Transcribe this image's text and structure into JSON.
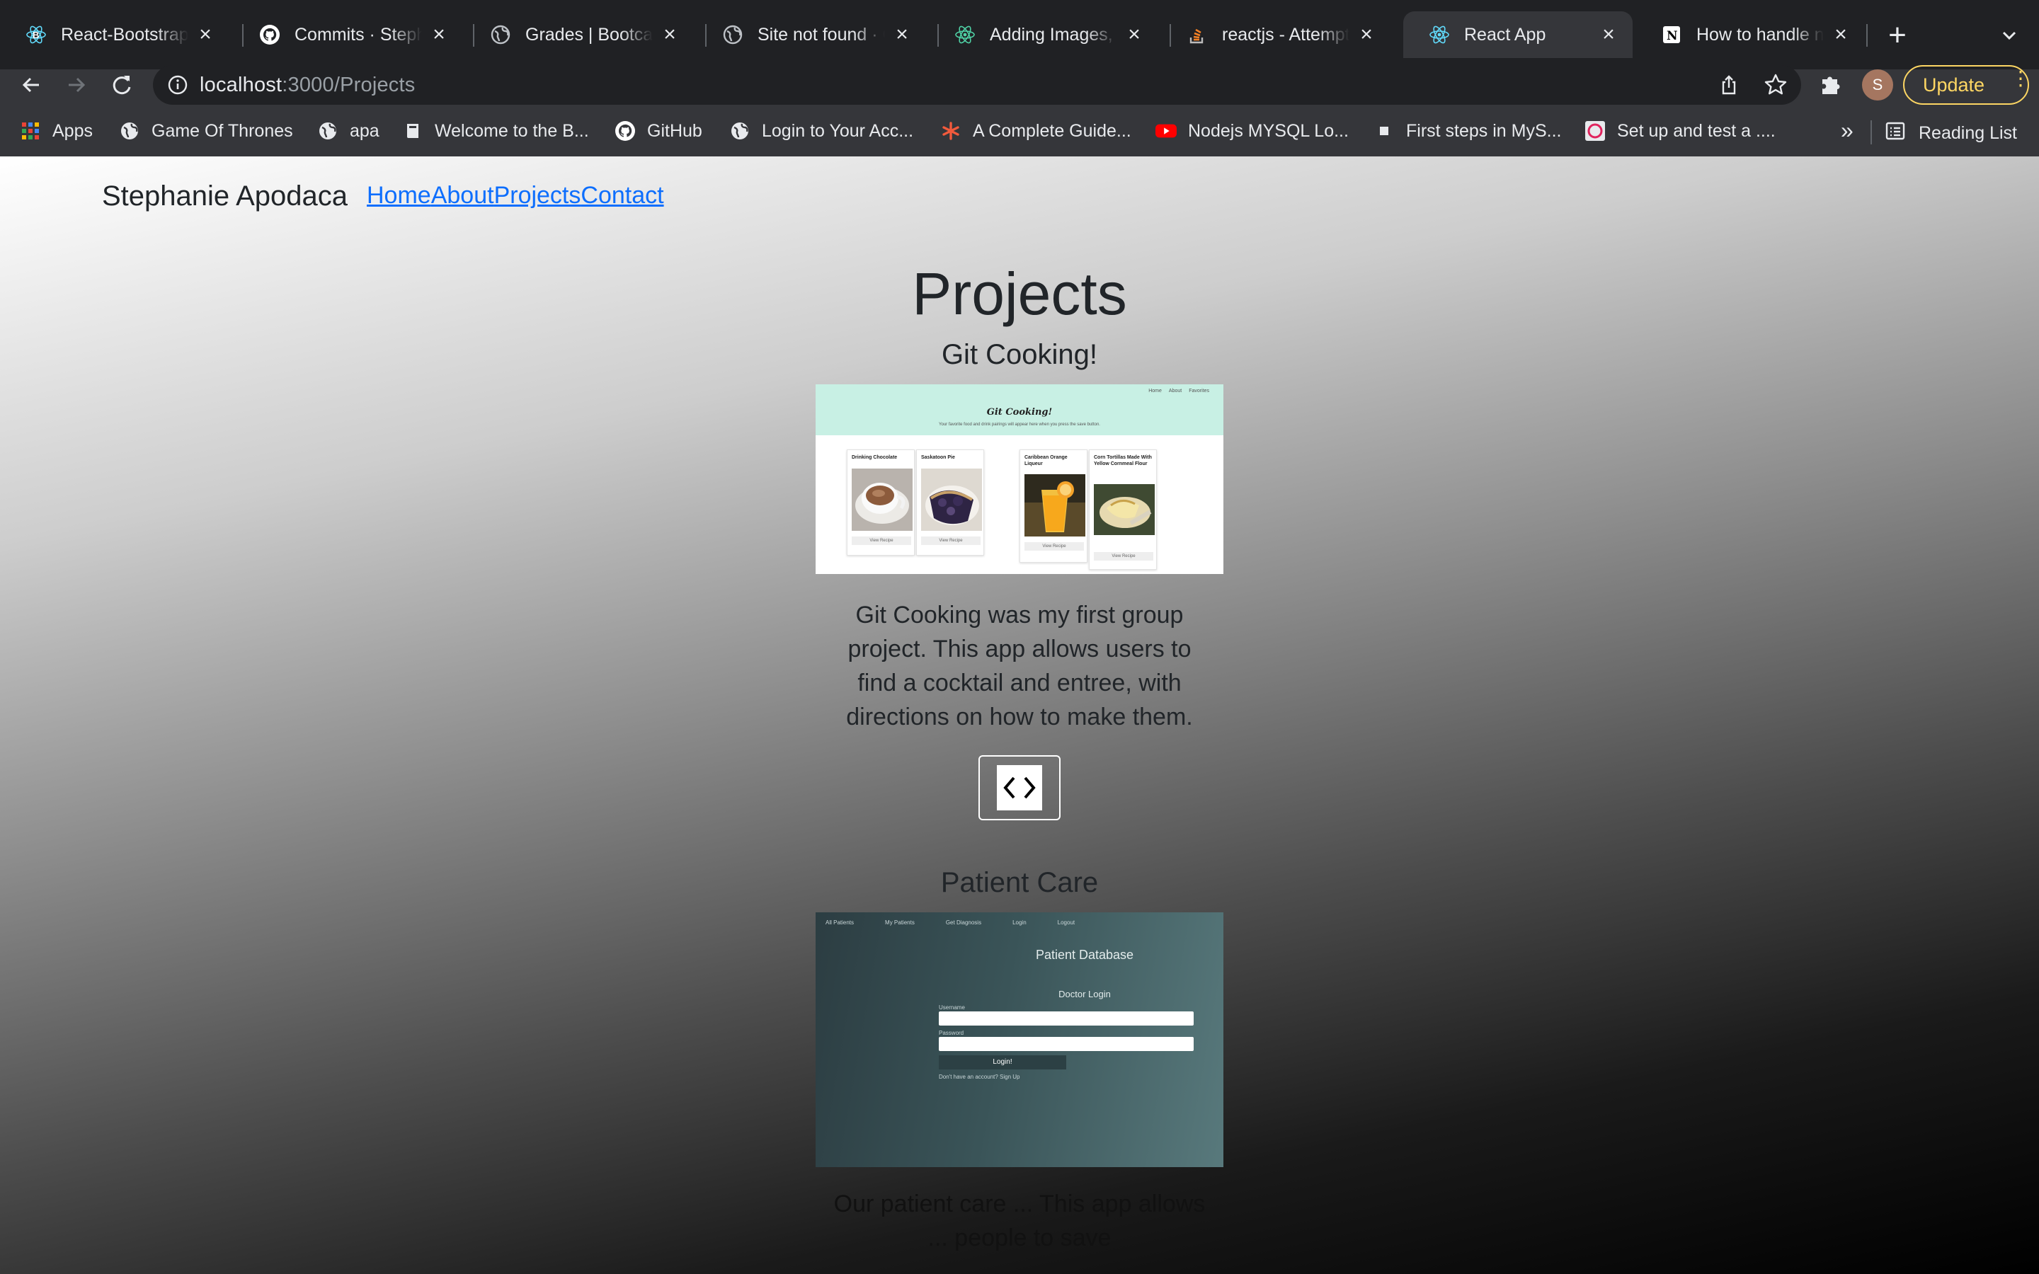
{
  "browser": {
    "tabs": [
      {
        "title": "React-Bootstrap",
        "icon": "react-bootstrap-icon"
      },
      {
        "title": "Commits · StephJ",
        "icon": "github-icon"
      },
      {
        "title": "Grades | Bootcamp",
        "icon": "globe-icon"
      },
      {
        "title": "Site not found · G",
        "icon": "globe-icon"
      },
      {
        "title": "Adding Images, F",
        "icon": "react-icon"
      },
      {
        "title": "reactjs - Attempt",
        "icon": "stackoverflow-icon"
      },
      {
        "title": "React App",
        "icon": "react-icon",
        "active": true
      },
      {
        "title": "How to handle na",
        "icon": "notion-icon"
      }
    ],
    "url_host": "localhost",
    "url_path": ":3000/Projects",
    "avatar_letter": "S",
    "update_label": "Update",
    "bookmarks": [
      {
        "label": "Apps",
        "icon": "apps-grid-icon"
      },
      {
        "label": "Game Of Thrones",
        "icon": "globe-icon"
      },
      {
        "label": "apa",
        "icon": "globe-icon"
      },
      {
        "label": "Welcome to the B...",
        "icon": "book-icon"
      },
      {
        "label": "GitHub",
        "icon": "github-icon"
      },
      {
        "label": "Login to Your Acc...",
        "icon": "globe-icon"
      },
      {
        "label": "A Complete Guide...",
        "icon": "asterisk-icon"
      },
      {
        "label": "Nodejs MYSQL Lo...",
        "icon": "youtube-icon"
      },
      {
        "label": "First steps in MyS...",
        "icon": "square-icon"
      },
      {
        "label": "Set up and test a ....",
        "icon": "badge-icon"
      }
    ],
    "bookmarks_more": "»",
    "reading_list": "Reading List"
  },
  "page": {
    "brand": "Stephanie Apodaca",
    "nav": [
      "Home",
      "About",
      "Projects",
      "Contact"
    ],
    "title": "Projects",
    "projects": [
      {
        "title": "Git Cooking!",
        "description": "Git Cooking was my first group project. This app allows users to find a cocktail and entree, with directions on how to make them.",
        "screenshot": {
          "nav": [
            "Home",
            "About",
            "Favorites"
          ],
          "heading": "Git Cooking!",
          "subheading": "Your favorite food and drink pairings will appear here when you press the save button.",
          "cards": [
            {
              "title": "Drinking Chocolate",
              "button": "View Recipe"
            },
            {
              "title": "Saskatoon Pie",
              "button": "View Recipe"
            },
            {
              "title": "Caribbean Orange Liqueur",
              "button": "View Recipe"
            },
            {
              "title": "Corn Tortillas Made With Yellow Cornmeal Flour",
              "button": "View Recipe"
            }
          ]
        }
      },
      {
        "title": "Patient Care",
        "description": "Our patient care ... This app allows ... people to save",
        "screenshot": {
          "nav": [
            "All Patients",
            "My Patients",
            "Get Diagnosis",
            "Login",
            "Logout"
          ],
          "heading": "Patient Database",
          "form_title": "Doctor Login",
          "username_label": "Username",
          "password_label": "Password",
          "button": "Login!",
          "signup": "Don't have an account? Sign Up"
        }
      }
    ]
  },
  "colors": {
    "link": "#0d6efd",
    "update_accent": "#fdd663",
    "chrome_dark": "#202124"
  }
}
